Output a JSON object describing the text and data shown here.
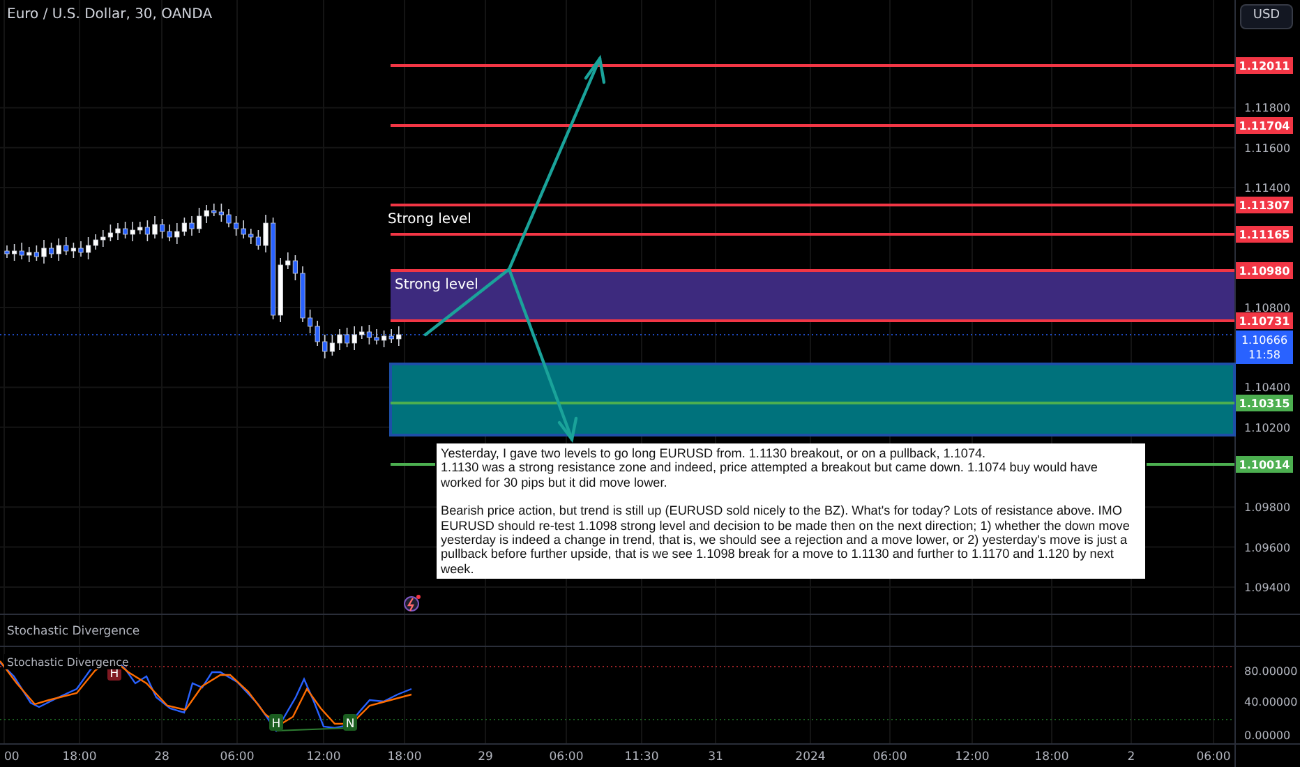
{
  "header": {
    "title": "Euro / U.S. Dollar, 30, OANDA"
  },
  "currency_button": "USD",
  "price_axis": {
    "ticks": [
      "1.11800",
      "1.11600",
      "1.11400",
      "1.10800",
      "1.10400",
      "1.10200",
      "1.09800",
      "1.09600",
      "1.09400"
    ]
  },
  "levels": [
    {
      "price": "1.12011",
      "color": "#f23645"
    },
    {
      "price": "1.11704",
      "color": "#f23645"
    },
    {
      "price": "1.11307",
      "color": "#f23645"
    },
    {
      "price": "1.11165",
      "color": "#f23645"
    },
    {
      "price": "1.10980",
      "color": "#f23645"
    },
    {
      "price": "1.10731",
      "color": "#f23645"
    },
    {
      "price": "1.10315",
      "color": "#4caf50"
    },
    {
      "price": "1.10014",
      "color": "#4caf50"
    }
  ],
  "current_price": {
    "price": "1.10666",
    "countdown": "11:58"
  },
  "zones": [
    {
      "color": "#3d2a7e"
    },
    {
      "color": "#00727c"
    }
  ],
  "annotations": [
    {
      "text": "Strong level"
    },
    {
      "text": "Strong level"
    }
  ],
  "note": {
    "paragraphs": [
      {
        "lines": [
          "Yesterday, I gave two levels to go long EURUSD from. 1.1130 breakout, or on a pullback, 1.1074.",
          "1.1130 was a strong resistance zone and indeed, price attempted a breakout but came down. 1.1074 buy would have worked for 30 pips but it did move lower."
        ]
      },
      {
        "lines": [
          "Bearish price action, but trend is still up (EURUSD sold nicely to the BZ). What's for today? Lots of resistance above. IMO EURUSD should re-test 1.1098 strong level and decision to be made then on the next direction; 1) whether the down move yesterday is indeed a change in trend, that is, we should see a rejection and a move lower, or 2) yesterday's move is just a pullback before further upside, that is we see 1.1098 break for a move to 1.1130 and further to 1.1170 and 1.120 by next week."
        ]
      }
    ]
  },
  "indicator": {
    "pane_title": "Stochastic Divergence",
    "legend": "Stochastic Divergence",
    "ticks": [
      "80.00000",
      "40.00000",
      "0.00000"
    ],
    "markers": [
      {
        "label": "H",
        "kind": "bearish"
      },
      {
        "label": "H",
        "kind": "bullish"
      },
      {
        "label": "N",
        "kind": "bullish"
      }
    ]
  },
  "time_axis": [
    "00",
    "18:00",
    "28",
    "06:00",
    "12:00",
    "18:00",
    "29",
    "06:00",
    "11:30",
    "31",
    "2024",
    "06:00",
    "12:00",
    "18:00",
    "2",
    "06:00"
  ]
}
